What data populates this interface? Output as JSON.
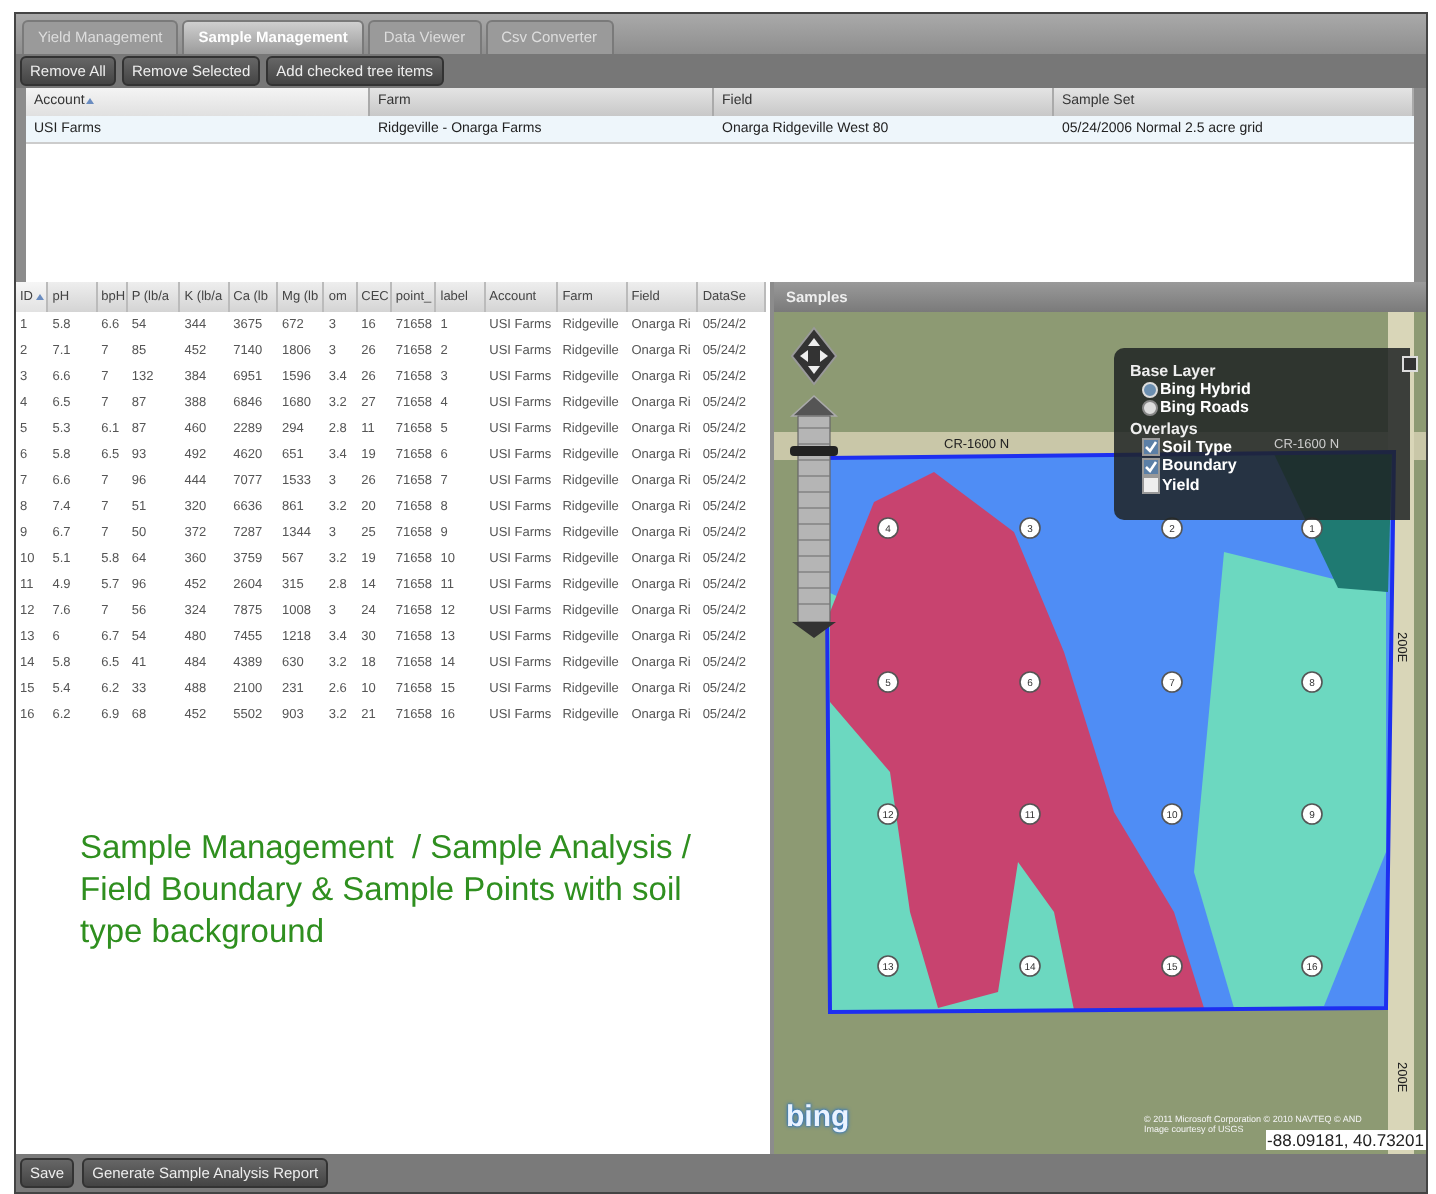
{
  "tabs": [
    {
      "label": "Yield Management",
      "selected": false
    },
    {
      "label": "Sample Management",
      "selected": true
    },
    {
      "label": "Data Viewer",
      "selected": false
    },
    {
      "label": "Csv Converter",
      "selected": false
    }
  ],
  "toolbar_buttons": [
    "Remove All",
    "Remove Selected",
    "Add checked tree items"
  ],
  "sample_sets": {
    "columns": [
      {
        "label": "Account",
        "sorted": true
      },
      {
        "label": "Farm",
        "sorted": false
      },
      {
        "label": "Field",
        "sorted": false
      },
      {
        "label": "Sample Set",
        "sorted": false
      }
    ],
    "rows": [
      {
        "cells": [
          "USI Farms",
          "Ridgeville - Onarga Farms",
          "Onarga Ridgeville West 80",
          "05/24/2006 Normal 2.5 acre grid"
        ],
        "selected": true
      }
    ]
  },
  "samples_table": {
    "columns": [
      {
        "label": "ID",
        "sorted": true
      },
      {
        "label": "pH",
        "sorted": false
      },
      {
        "label": "bpH",
        "sorted": false
      },
      {
        "label": "P (lb/a",
        "sorted": false
      },
      {
        "label": "K (lb/a",
        "sorted": false
      },
      {
        "label": "Ca (lb",
        "sorted": false
      },
      {
        "label": "Mg (lb",
        "sorted": false
      },
      {
        "label": "om",
        "sorted": false
      },
      {
        "label": "CEC",
        "sorted": false
      },
      {
        "label": "point_",
        "sorted": false
      },
      {
        "label": "label",
        "sorted": false
      },
      {
        "label": "Account",
        "sorted": false
      },
      {
        "label": "Farm",
        "sorted": false
      },
      {
        "label": "Field",
        "sorted": false
      },
      {
        "label": "DataSe",
        "sorted": false
      }
    ],
    "rows": [
      [
        "1",
        "5.8",
        "6.6",
        "54",
        "344",
        "3675",
        "672",
        "3",
        "16",
        "71658",
        "1",
        "USI Farms",
        "Ridgeville",
        "Onarga Ri",
        "05/24/2"
      ],
      [
        "2",
        "7.1",
        "7",
        "85",
        "452",
        "7140",
        "1806",
        "3",
        "26",
        "71658",
        "2",
        "USI Farms",
        "Ridgeville",
        "Onarga Ri",
        "05/24/2"
      ],
      [
        "3",
        "6.6",
        "7",
        "132",
        "384",
        "6951",
        "1596",
        "3.4",
        "26",
        "71658",
        "3",
        "USI Farms",
        "Ridgeville",
        "Onarga Ri",
        "05/24/2"
      ],
      [
        "4",
        "6.5",
        "7",
        "87",
        "388",
        "6846",
        "1680",
        "3.2",
        "27",
        "71658",
        "4",
        "USI Farms",
        "Ridgeville",
        "Onarga Ri",
        "05/24/2"
      ],
      [
        "5",
        "5.3",
        "6.1",
        "87",
        "460",
        "2289",
        "294",
        "2.8",
        "11",
        "71658",
        "5",
        "USI Farms",
        "Ridgeville",
        "Onarga Ri",
        "05/24/2"
      ],
      [
        "6",
        "5.8",
        "6.5",
        "93",
        "492",
        "4620",
        "651",
        "3.4",
        "19",
        "71658",
        "6",
        "USI Farms",
        "Ridgeville",
        "Onarga Ri",
        "05/24/2"
      ],
      [
        "7",
        "6.6",
        "7",
        "96",
        "444",
        "7077",
        "1533",
        "3",
        "26",
        "71658",
        "7",
        "USI Farms",
        "Ridgeville",
        "Onarga Ri",
        "05/24/2"
      ],
      [
        "8",
        "7.4",
        "7",
        "51",
        "320",
        "6636",
        "861",
        "3.2",
        "20",
        "71658",
        "8",
        "USI Farms",
        "Ridgeville",
        "Onarga Ri",
        "05/24/2"
      ],
      [
        "9",
        "6.7",
        "7",
        "50",
        "372",
        "7287",
        "1344",
        "3",
        "25",
        "71658",
        "9",
        "USI Farms",
        "Ridgeville",
        "Onarga Ri",
        "05/24/2"
      ],
      [
        "10",
        "5.1",
        "5.8",
        "64",
        "360",
        "3759",
        "567",
        "3.2",
        "19",
        "71658",
        "10",
        "USI Farms",
        "Ridgeville",
        "Onarga Ri",
        "05/24/2"
      ],
      [
        "11",
        "4.9",
        "5.7",
        "96",
        "452",
        "2604",
        "315",
        "2.8",
        "14",
        "71658",
        "11",
        "USI Farms",
        "Ridgeville",
        "Onarga Ri",
        "05/24/2"
      ],
      [
        "12",
        "7.6",
        "7",
        "56",
        "324",
        "7875",
        "1008",
        "3",
        "24",
        "71658",
        "12",
        "USI Farms",
        "Ridgeville",
        "Onarga Ri",
        "05/24/2"
      ],
      [
        "13",
        "6",
        "6.7",
        "54",
        "480",
        "7455",
        "1218",
        "3.4",
        "30",
        "71658",
        "13",
        "USI Farms",
        "Ridgeville",
        "Onarga Ri",
        "05/24/2"
      ],
      [
        "14",
        "5.8",
        "6.5",
        "41",
        "484",
        "4389",
        "630",
        "3.2",
        "18",
        "71658",
        "14",
        "USI Farms",
        "Ridgeville",
        "Onarga Ri",
        "05/24/2"
      ],
      [
        "15",
        "5.4",
        "6.2",
        "33",
        "488",
        "2100",
        "231",
        "2.6",
        "10",
        "71658",
        "15",
        "USI Farms",
        "Ridgeville",
        "Onarga Ri",
        "05/24/2"
      ],
      [
        "16",
        "6.2",
        "6.9",
        "68",
        "452",
        "5502",
        "903",
        "3.2",
        "21",
        "71658",
        "16",
        "USI Farms",
        "Ridgeville",
        "Onarga Ri",
        "05/24/2"
      ]
    ]
  },
  "caption": "Sample Management  / Sample Analysis / Field Boundary & Sample Points with soil type background",
  "map": {
    "title": "Samples",
    "zoom_slider": {
      "level": 0.85
    },
    "layer_switcher": {
      "base_heading": "Base Layer",
      "base_layers": [
        {
          "label": "Bing Hybrid",
          "selected": true
        },
        {
          "label": "Bing Roads",
          "selected": false
        }
      ],
      "overlay_heading": "Overlays",
      "overlays": [
        {
          "label": "Soil Type",
          "checked": true
        },
        {
          "label": "Boundary",
          "checked": true
        },
        {
          "label": "Yield",
          "checked": false
        }
      ]
    },
    "road_labels": [
      "CR-1600 N",
      "CR-1600 N",
      "200E",
      "200E"
    ],
    "sample_points": [
      "4",
      "3",
      "2",
      "1",
      "5",
      "6",
      "7",
      "8",
      "12",
      "11",
      "10",
      "9",
      "13",
      "14",
      "15",
      "16"
    ],
    "logo": "bing",
    "attribution": [
      "© 2011 Microsoft Corporation  © 2010 NAVTEQ  © AND",
      "Image courtesy of USGS"
    ],
    "coordinates": "-88.09181, 40.73201"
  },
  "footer_buttons": [
    "Save",
    "Generate Sample Analysis Report"
  ]
}
